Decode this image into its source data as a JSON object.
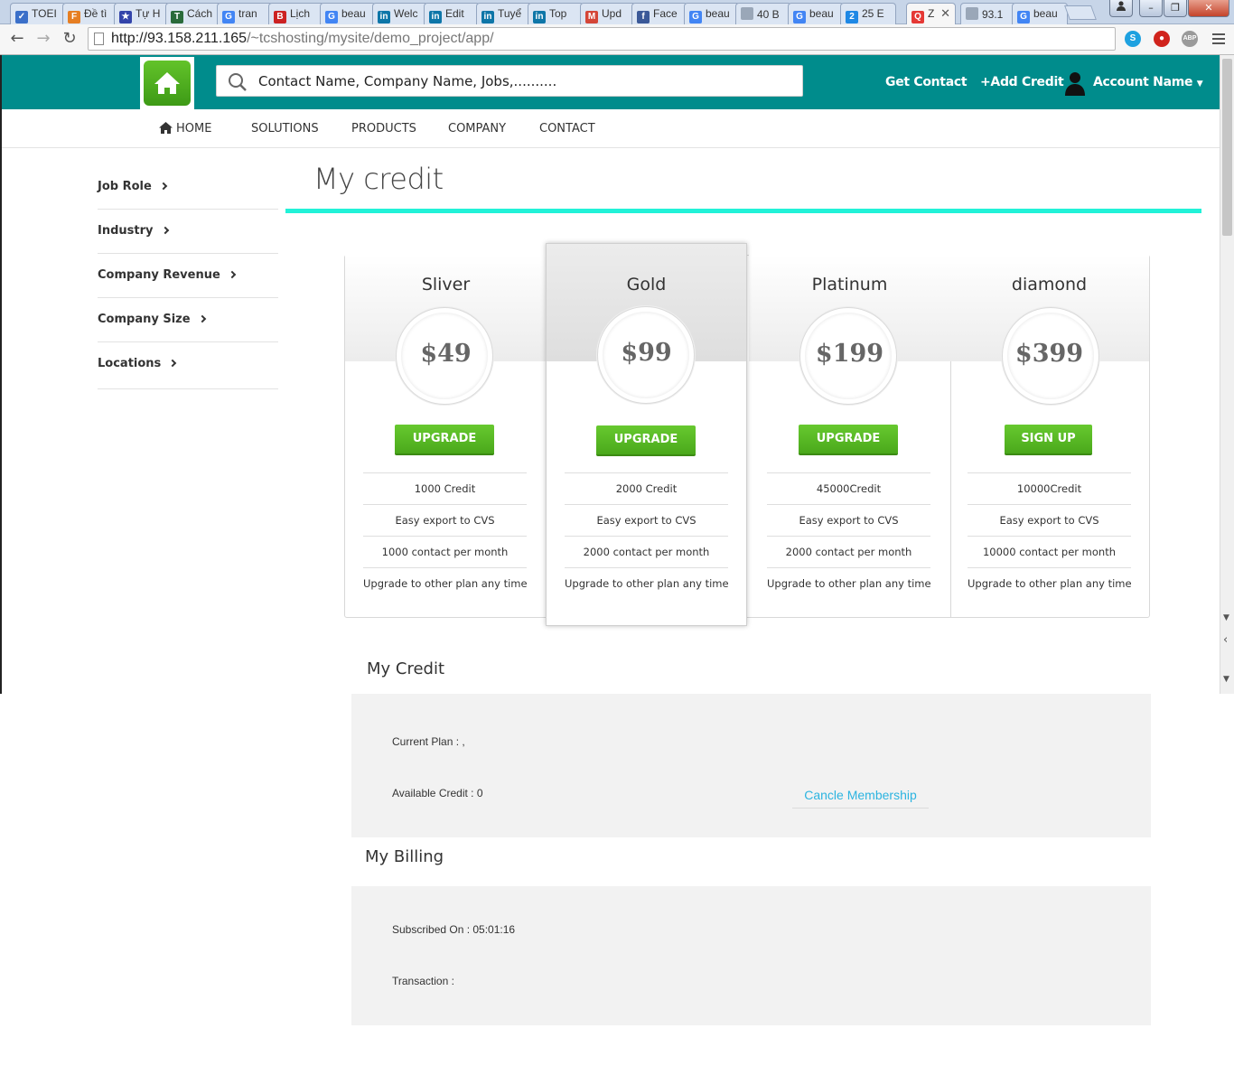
{
  "browser": {
    "tabs": [
      {
        "label": "TOEI",
        "color": "#3a6fc9",
        "glyph": "✓"
      },
      {
        "label": "Đề tì",
        "color": "#e67e22",
        "glyph": "F"
      },
      {
        "label": "Tự H",
        "color": "#3344aa",
        "glyph": "★"
      },
      {
        "label": "Cách",
        "color": "#2a6b3a",
        "glyph": "T"
      },
      {
        "label": "tran",
        "color": "#4285f4",
        "glyph": "G"
      },
      {
        "label": "Lịch",
        "color": "#cc2222",
        "glyph": "B"
      },
      {
        "label": "beau",
        "color": "#4285f4",
        "glyph": "G"
      },
      {
        "label": "Welc",
        "color": "#0e76a8",
        "glyph": "in"
      },
      {
        "label": "Edit",
        "color": "#0e76a8",
        "glyph": "in"
      },
      {
        "label": "Tuyể",
        "color": "#0e76a8",
        "glyph": "in"
      },
      {
        "label": "Top",
        "color": "#0e76a8",
        "glyph": "in"
      },
      {
        "label": "Upd",
        "color": "#d44638",
        "glyph": "M"
      },
      {
        "label": "Face",
        "color": "#3b5998",
        "glyph": "f"
      },
      {
        "label": "beau",
        "color": "#4285f4",
        "glyph": "G"
      },
      {
        "label": "40 B",
        "color": "#9aa7b8",
        "glyph": ""
      },
      {
        "label": "beau",
        "color": "#4285f4",
        "glyph": "G"
      },
      {
        "label": "25 E",
        "color": "#1e88e5",
        "glyph": "2"
      },
      {
        "label": "Z",
        "color": "#e53935",
        "glyph": "Q"
      },
      {
        "label": "93.1",
        "color": "#9aa7b8",
        "glyph": ""
      },
      {
        "label": "beau",
        "color": "#4285f4",
        "glyph": "G"
      }
    ],
    "active_tab": 17,
    "url_host": "http://93.158.211.165",
    "url_path": "/~tcshosting/mysite/demo_project/app/",
    "extensions": [
      {
        "label": "S",
        "color": "#1ea1e0"
      },
      {
        "label": "●",
        "color": "#d0231c"
      },
      {
        "label": "ABP",
        "color": "#9a9a9a"
      }
    ]
  },
  "header": {
    "search_placeholder": "Contact Name, Company Name, Jobs,..........",
    "get_contact": "Get Contact",
    "add_credit": "+Add Credit",
    "account_name": "Account Name",
    "accent_color": "#008c8c"
  },
  "nav": {
    "home": "HOME",
    "solutions": "SOLUTIONS",
    "products": "PRODUCTS",
    "company": "COMPANY",
    "contact": "CONTACT"
  },
  "sidebar": {
    "items": [
      {
        "label": "Job Role"
      },
      {
        "label": "Industry"
      },
      {
        "label": "Company Revenue"
      },
      {
        "label": "Company Size"
      },
      {
        "label": "Locations"
      }
    ]
  },
  "page": {
    "title": "My credit"
  },
  "plans": [
    {
      "name": "Sliver",
      "price": "$49",
      "button": "UPGRADE",
      "features": [
        "1000 Credit",
        "Easy export to CVS",
        "1000 contact per month",
        "Upgrade to other plan any time"
      ]
    },
    {
      "name": "Gold",
      "price": "$99",
      "button": "UPGRADE",
      "features": [
        "2000 Credit",
        "Easy export to CVS",
        "2000 contact per month",
        "Upgrade to other plan any time"
      ]
    },
    {
      "name": "Platinum",
      "price": "$199",
      "button": "UPGRADE",
      "features": [
        "45000Credit",
        "Easy export to CVS",
        "2000 contact per month",
        "Upgrade to other plan any time"
      ]
    },
    {
      "name": "diamond",
      "price": "$399",
      "button": "SIGN UP",
      "features": [
        "10000Credit",
        "Easy export to CVS",
        "10000 contact per month",
        "Upgrade to other plan any time"
      ]
    }
  ],
  "credit": {
    "title": "My Credit",
    "current_plan": "Current Plan : ,",
    "available_credit": "Available Credit : 0",
    "cancel": "Cancle Membership"
  },
  "billing": {
    "title": "My Billing",
    "subscribed_on": "Subscribed On : 05:01:16",
    "transaction": "Transaction :"
  }
}
